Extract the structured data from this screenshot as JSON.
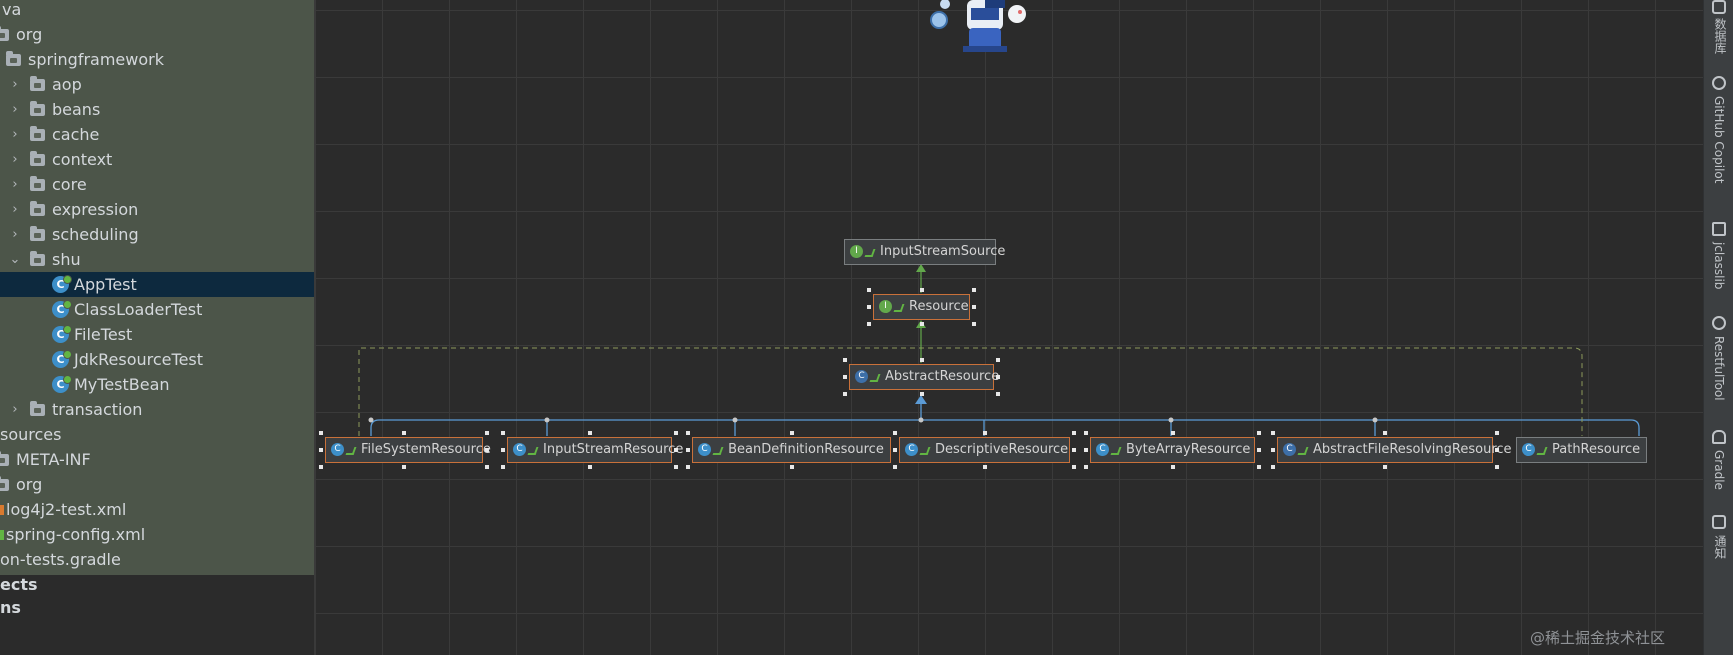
{
  "tree": {
    "rows": [
      {
        "label": "va",
        "type": "folder"
      },
      {
        "label": "org",
        "type": "folder"
      },
      {
        "label": "springframework",
        "type": "folder"
      },
      {
        "label": "aop",
        "type": "folder",
        "chevron": "›"
      },
      {
        "label": "beans",
        "type": "folder",
        "chevron": "›"
      },
      {
        "label": "cache",
        "type": "folder",
        "chevron": "›"
      },
      {
        "label": "context",
        "type": "folder",
        "chevron": "›"
      },
      {
        "label": "core",
        "type": "folder",
        "chevron": "›"
      },
      {
        "label": "expression",
        "type": "folder",
        "chevron": "›"
      },
      {
        "label": "scheduling",
        "type": "folder",
        "chevron": "›"
      },
      {
        "label": "shu",
        "type": "folder",
        "chevron": "⌄"
      },
      {
        "label": "AppTest",
        "type": "class"
      },
      {
        "label": "ClassLoaderTest",
        "type": "class"
      },
      {
        "label": "FileTest",
        "type": "class"
      },
      {
        "label": "JdkResourceTest",
        "type": "class"
      },
      {
        "label": "MyTestBean",
        "type": "class"
      },
      {
        "label": "transaction",
        "type": "folder",
        "chevron": "›"
      },
      {
        "label": "sources",
        "type": "text"
      },
      {
        "label": "META-INF",
        "type": "folder"
      },
      {
        "label": "org",
        "type": "folder"
      },
      {
        "label": "log4j2-test.xml",
        "type": "file"
      },
      {
        "label": "spring-config.xml",
        "type": "file"
      },
      {
        "label": "on-tests.gradle",
        "type": "text"
      }
    ],
    "footer": [
      "ects",
      "ns"
    ]
  },
  "diagram": {
    "nodes": {
      "input_stream_source": "InputStreamSource",
      "resource": "Resource",
      "abstract_resource": "AbstractResource",
      "file_system_resource": "FileSystemResource",
      "input_stream_resource": "InputStreamResource",
      "bean_definition_resource": "BeanDefinitionResource",
      "descriptive_resource": "DescriptiveResource",
      "byte_array_resource": "ByteArrayResource",
      "abstract_file_resolving_resource": "AbstractFileResolvingResource",
      "path_resource": "PathResource"
    },
    "icons": {
      "class": "C",
      "interface": "I"
    }
  },
  "tool_strip": {
    "items": [
      "数据库",
      "GitHub Copilot",
      "jclasslib",
      "RestfulTool",
      "Gradle",
      "通知"
    ]
  },
  "watermark": "@稀土掘金技术社区",
  "colors": {
    "selection": "#0d293e",
    "node_border_selected": "#c9713a",
    "inheritance_arrow": "#5b9bd5",
    "interface_arrow": "#62a84b",
    "dashed_link": "#8c9a5b"
  }
}
